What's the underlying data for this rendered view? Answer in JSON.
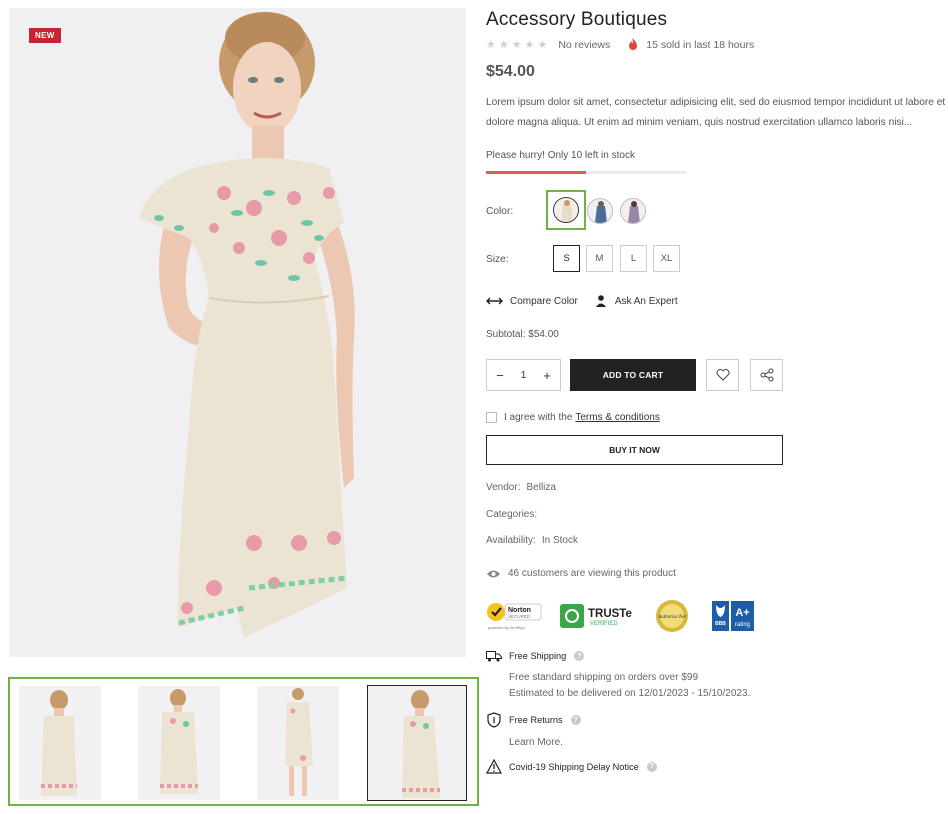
{
  "gallery": {
    "badge": "NEW",
    "thumbnails": [
      {
        "name": "back-view",
        "active": false
      },
      {
        "name": "front-view",
        "active": false
      },
      {
        "name": "full-view",
        "active": false
      },
      {
        "name": "pose-view",
        "active": true
      }
    ]
  },
  "product": {
    "title": "Accessory Boutiques",
    "stars": "★★★★★",
    "reviews": "No reviews",
    "sold": "15 sold in last 18 hours",
    "price": "$54.00",
    "description": "Lorem ipsum dolor sit amet, consectetur adipisicing elit, sed do eiusmod tempor incididunt ut labore et dolore magna aliqua. Ut enim ad minim veniam, quis nostrud exercitation ullamco laboris nisi...",
    "stock_text": "Please hurry! Only 10 left in stock",
    "stock_level": 0.5
  },
  "options": {
    "color_label": "Color:",
    "size_label": "Size:",
    "sizes": [
      "S",
      "M",
      "L",
      "XL"
    ],
    "selected_size": "S"
  },
  "actions": {
    "compare": "Compare Color",
    "expert": "Ask An Expert",
    "subtotal": "Subtotal: $54.00",
    "quantity": "1",
    "minus": "−",
    "plus": "+",
    "add_to_cart": "ADD TO CART",
    "terms_prefix": "I agree with the",
    "terms_link": "Terms & conditions",
    "buy_now": "BUY IT NOW"
  },
  "meta": {
    "vendor_label": "Vendor:",
    "vendor": "Belliza",
    "categories_label": "Categories:",
    "availability_label": "Availability:",
    "availability": "In Stock",
    "viewing": "46 customers are viewing this product"
  },
  "trust": {
    "norton_title": "Norton",
    "norton_sub": "SECURED",
    "norton_powered": "powered by VeriSign",
    "truste_title": "TRUSTe",
    "truste_sub": "VERIFIED",
    "authorize": "Authorize.Net",
    "bbb": "BBB",
    "aplus": "A+",
    "rating": "rating"
  },
  "shipping": {
    "free_shipping": "Free Shipping",
    "free_shipping_line1": "Free standard shipping on orders over $99",
    "free_shipping_line2": "Estimated to be delivered on 12/01/2023 - 15/10/2023.",
    "free_returns": "Free Returns",
    "learn_more": "Learn More.",
    "covid": "Covid-19 Shipping Delay Notice",
    "help": "?"
  },
  "colors": {
    "accent_green": "#6db33f",
    "badge_red": "#c8242f",
    "stock_red": "#de5a62",
    "dark": "#222222",
    "fire": "#e4453a"
  }
}
